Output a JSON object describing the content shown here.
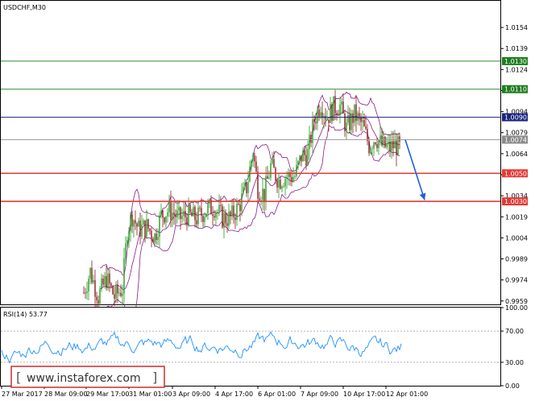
{
  "chart_data": [
    {
      "type": "candlestick",
      "title": "USDCHF,M30",
      "ylim": [
        0.9956,
        1.0173
      ],
      "y_ticks": [
        "1.0154",
        "1.0139",
        "1.0124",
        "1.0109",
        "1.0094",
        "1.0079",
        "1.0064",
        "1.0049",
        "1.0034",
        "1.0019",
        "1.0004",
        "0.9989",
        "0.9974",
        "0.9959"
      ],
      "x_labels": [
        "27 Mar 2017",
        "28 Mar 09:00",
        "29 Mar 17:00",
        "31 Mar 01:00",
        "3 Apr 09:00",
        "4 Apr 17:00",
        "6 Apr 01:00",
        "7 Apr 09:00",
        "10 Apr 17:00",
        "12 Apr 01:00"
      ],
      "levels": [
        {
          "value": 1.013,
          "label": "1.0130",
          "color": "#1e7d1e",
          "line_color": "#2e8b2e"
        },
        {
          "value": 1.011,
          "label": "1.0110",
          "color": "#1e7d1e",
          "line_color": "#2e8b2e"
        },
        {
          "value": 1.009,
          "label": "1.0090",
          "color": "#1a237e",
          "line_color": "#1a237e"
        },
        {
          "value": 1.0074,
          "label": "1.0074",
          "color": "#8a8a8a",
          "line_color": "#9e9e9e"
        },
        {
          "value": 1.005,
          "label": "1.0050",
          "color": "#e53935",
          "line_color": "#e53935"
        },
        {
          "value": 1.003,
          "label": "1.0030",
          "color": "#e53935",
          "line_color": "#e53935"
        }
      ],
      "arrow": {
        "from": 1.0074,
        "to": 1.0031,
        "color": "#1f5fe0"
      },
      "colors": {
        "bull": "#1f9e1f",
        "bear": "#8b1a1a",
        "bands": "#8b1c8b"
      }
    },
    {
      "type": "line",
      "title": "RSI(14) 53.77",
      "ylim": [
        0,
        100
      ],
      "y_ticks": [
        "100.00",
        "70.00",
        "30.00",
        "0.00"
      ],
      "levels": [
        70,
        30
      ],
      "last_value": 53.77,
      "color": "#1e90ff"
    }
  ],
  "watermark": "www.instaforex.com"
}
